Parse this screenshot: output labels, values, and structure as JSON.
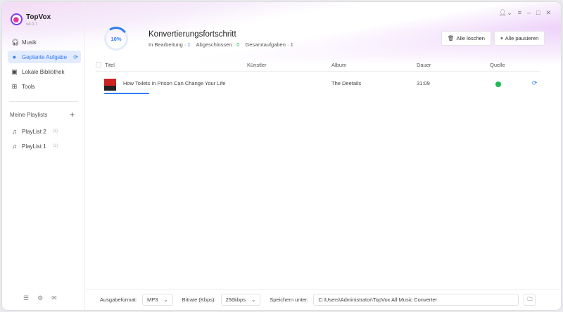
{
  "app": {
    "name": "TopVox",
    "version": "v4.0.7"
  },
  "sidebar": {
    "items": [
      {
        "label": "Musik",
        "icon": "headphones-icon"
      },
      {
        "label": "Geplante Aufgabe",
        "icon": "download-icon"
      },
      {
        "label": "Lokale Bibliothek",
        "icon": "library-icon"
      },
      {
        "label": "Tools",
        "icon": "grid-icon"
      }
    ],
    "playlists_title": "Meine Playlists",
    "playlists": [
      {
        "label": "PlayList 2",
        "count": "(1)"
      },
      {
        "label": "PlayList 1",
        "count": "(1)"
      }
    ]
  },
  "progress": {
    "percent": "10%",
    "title": "Konvertierungsfortschritt",
    "in_progress_label": "In Bearbeitung ·",
    "in_progress": "1",
    "done_label": "Abgeschlossen ·",
    "done": "0",
    "total_label": "Gesamtaufgaben · 1"
  },
  "buttons": {
    "clear": "Alle löschen",
    "pause": "Alle pausieren"
  },
  "table": {
    "headers": [
      "Titel",
      "Künstler",
      "Album",
      "Dauer",
      "Quelle"
    ],
    "rows": [
      {
        "title": "How Toilets In Prison Can Change Your Life",
        "artist": "",
        "album": "The Deetails",
        "duration": "31:09",
        "source": "spotify"
      }
    ]
  },
  "footer": {
    "format_label": "Ausgabeformat:",
    "format": "MP3",
    "bitrate_label": "Bitrate (Kbps):",
    "bitrate": "256kbps",
    "save_label": "Speichern unter:",
    "path": "C:\\Users\\Administrator\\TopVox All Music Converter"
  },
  "colors": {
    "accent": "#2f7cf6",
    "spotify": "#1db954"
  }
}
